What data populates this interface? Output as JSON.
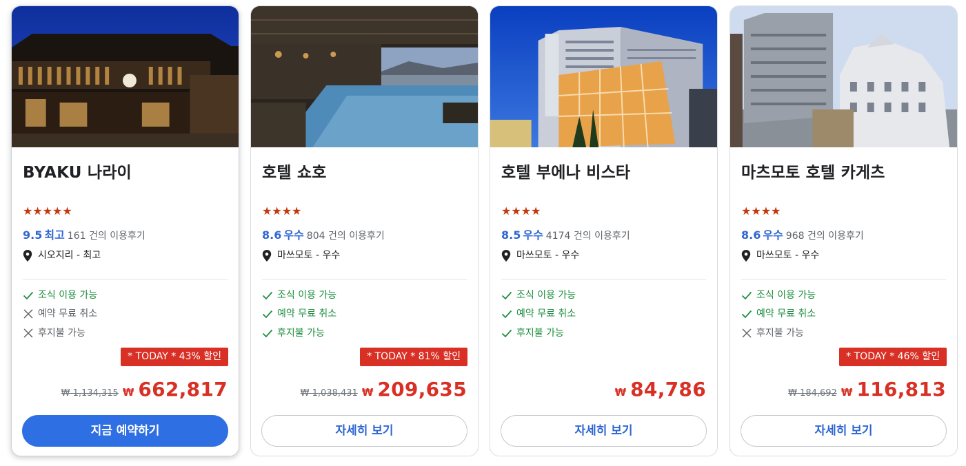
{
  "hotels": [
    {
      "name": "BYAKU 나라이",
      "stars": "★★★★★",
      "score": "9.5",
      "score_label": "최고",
      "review_count": "161",
      "review_suffix": "건의 이용후기",
      "location": "시오지리 - 최고",
      "features": [
        {
          "label": "조식 이용 가능",
          "available": true
        },
        {
          "label": "예약 무료 취소",
          "available": false
        },
        {
          "label": "후지불 가능",
          "available": false
        }
      ],
      "badge": "* TODAY * 43% 할인",
      "original_price": "₩ 1,134,315",
      "currency": "₩",
      "price": "662,817",
      "button": "지금 예약하기"
    },
    {
      "name": "호텔 쇼호",
      "stars": "★★★★",
      "score": "8.6",
      "score_label": "우수",
      "review_count": "804",
      "review_suffix": "건의 이용후기",
      "location": "마쓰모토 - 우수",
      "features": [
        {
          "label": "조식 이용 가능",
          "available": true
        },
        {
          "label": "예약 무료 취소",
          "available": true
        },
        {
          "label": "후지불 가능",
          "available": true
        }
      ],
      "badge": "* TODAY * 81% 할인",
      "original_price": "₩ 1,038,431",
      "currency": "₩",
      "price": "209,635",
      "button": "자세히 보기"
    },
    {
      "name": "호텔 부에나 비스타",
      "stars": "★★★★",
      "score": "8.5",
      "score_label": "우수",
      "review_count": "4174",
      "review_suffix": "건의 이용후기",
      "location": "마쓰모토 - 우수",
      "features": [
        {
          "label": "조식 이용 가능",
          "available": true
        },
        {
          "label": "예약 무료 취소",
          "available": true
        },
        {
          "label": "후지불 가능",
          "available": true
        }
      ],
      "badge": "",
      "original_price": "",
      "currency": "₩",
      "price": "84,786",
      "button": "자세히 보기"
    },
    {
      "name": "마츠모토 호텔 카게츠",
      "stars": "★★★★",
      "score": "8.6",
      "score_label": "우수",
      "review_count": "968",
      "review_suffix": "건의 이용후기",
      "location": "마쓰모토 - 우수",
      "features": [
        {
          "label": "조식 이용 가능",
          "available": true
        },
        {
          "label": "예약 무료 취소",
          "available": true
        },
        {
          "label": "후지불 가능",
          "available": false
        }
      ],
      "badge": "* TODAY * 46% 할인",
      "original_price": "₩ 184,692",
      "currency": "₩",
      "price": "116,813",
      "button": "자세히 보기"
    }
  ],
  "colors": {
    "accent_blue": "#2f66d3",
    "primary_button": "#2f6fe4",
    "discount_red": "#d93025",
    "star_orange": "#c5360c",
    "available_green": "#1e8e3e"
  },
  "icons": {
    "location": "map-pin-icon",
    "available": "check-icon",
    "unavailable": "x-icon"
  }
}
